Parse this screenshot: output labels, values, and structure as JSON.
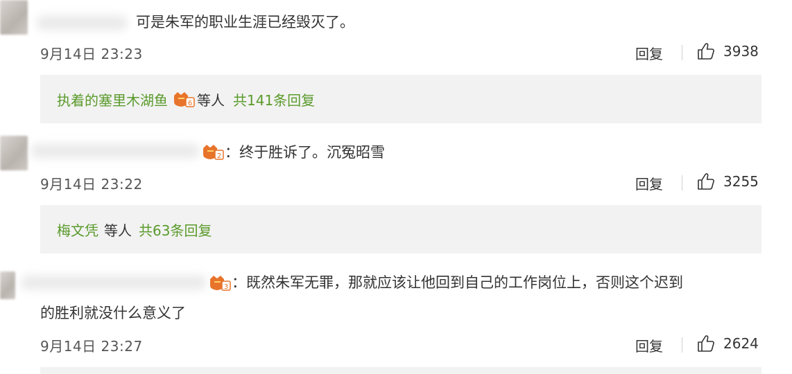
{
  "comments": [
    {
      "text": "可是朱军的职业生涯已经毁灭了。",
      "time": "9月14日 23:23",
      "reply_label": "回复",
      "like_count": "3938",
      "replies_summary": {
        "user": "执着的塞里木湖鱼",
        "level": "6",
        "others": "等人",
        "total": "共141条回复"
      }
    },
    {
      "level": "2",
      "text": "终于胜诉了。沉冤昭雪",
      "time": "9月14日 23:22",
      "reply_label": "回复",
      "like_count": "3255",
      "replies_summary": {
        "user": "梅文凭",
        "others": "等人",
        "total": "共63条回复"
      }
    },
    {
      "level": "3",
      "text_line1": "既然朱军无罪，那就应该让他回到自己的工作岗位上，否则这个迟到",
      "text_line2": "的胜利就没什么意义了",
      "time": "9月14日 23:27",
      "reply_label": "回复",
      "like_count": "2624"
    }
  ],
  "icons": {
    "like": "thumbs-up-icon",
    "badge": "user-level-badge-icon"
  },
  "colors": {
    "link_green": "#5a9a2b",
    "reply_bg": "#f2f2f2",
    "badge_orange": "#e8742b"
  }
}
